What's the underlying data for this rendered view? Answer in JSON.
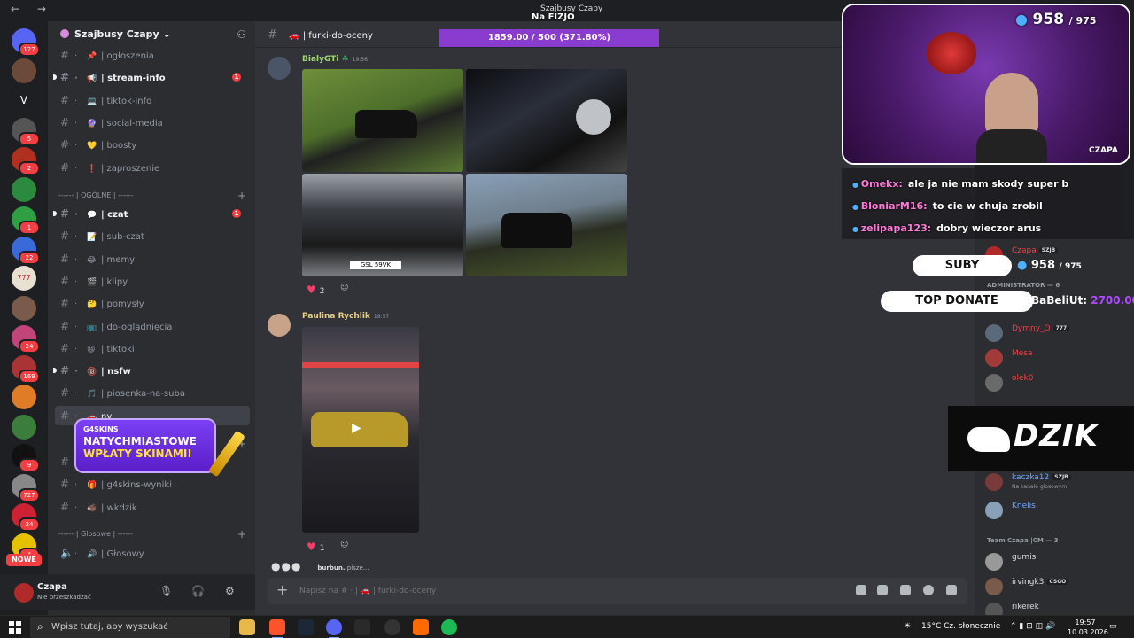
{
  "window": {
    "title": "Szajbusy Czapy"
  },
  "rail": {
    "servers": [
      {
        "badge": "127",
        "color": "#5865f2"
      },
      {
        "badge": "",
        "color": "#6b4a3a"
      },
      {
        "badge": "",
        "letter": "V",
        "color": "#1e1f22"
      },
      {
        "badge": "5",
        "color": "#555"
      },
      {
        "badge": "2",
        "color": "#b0301f"
      },
      {
        "badge": "",
        "color": "#2b8a3e"
      },
      {
        "badge": "1",
        "color": "#2ea043"
      },
      {
        "badge": "22",
        "color": "#3a6ad9"
      },
      {
        "badge": "",
        "letter": "777",
        "color": "#e8e0d0"
      },
      {
        "badge": "",
        "color": "#7a5a4a"
      },
      {
        "badge": "24",
        "color": "#c2457a"
      },
      {
        "badge": "169",
        "color": "#a33"
      },
      {
        "badge": "",
        "color": "#e07b28"
      },
      {
        "badge": "",
        "color": "#3b7d3b"
      },
      {
        "badge": "9",
        "color": "#111"
      },
      {
        "badge": "727",
        "color": "#888"
      },
      {
        "badge": "34",
        "color": "#c23"
      },
      {
        "badge": "4",
        "color": "#e5c100"
      }
    ],
    "nowe": "NOWE"
  },
  "sidebar": {
    "server_name": "Szajbusy Czapy",
    "channels_top": [
      {
        "emoji": "📌",
        "name": "| ogłoszenia",
        "bold": false,
        "badge": ""
      },
      {
        "emoji": "📢",
        "name": "| stream-info",
        "bold": true,
        "badge": "1"
      },
      {
        "emoji": "💻",
        "name": "| tiktok-info",
        "bold": false,
        "badge": ""
      },
      {
        "emoji": "🔮",
        "name": "| social-media",
        "bold": false,
        "badge": ""
      },
      {
        "emoji": "💛",
        "name": "| boosty",
        "bold": false,
        "badge": ""
      },
      {
        "emoji": "❗",
        "name": "| zaproszenie",
        "bold": false,
        "badge": ""
      }
    ],
    "category_general": "------ | OGÓLNE | ------",
    "channels_general": [
      {
        "emoji": "💬",
        "name": "| czat",
        "bold": true,
        "badge": "1"
      },
      {
        "emoji": "📝",
        "name": "| sub-czat",
        "bold": false,
        "badge": ""
      },
      {
        "emoji": "😂",
        "name": "| memy",
        "bold": false,
        "badge": ""
      },
      {
        "emoji": "🎬",
        "name": "| klipy",
        "bold": false,
        "badge": ""
      },
      {
        "emoji": "🤔",
        "name": "| pomysły",
        "bold": false,
        "badge": ""
      },
      {
        "emoji": "📺",
        "name": "| do-oglądnięcia",
        "bold": false,
        "badge": ""
      },
      {
        "emoji": "😆",
        "name": "| tiktoki",
        "bold": false,
        "badge": ""
      },
      {
        "emoji": "🔞",
        "name": "| nsfw",
        "bold": true,
        "badge": ""
      },
      {
        "emoji": "🎵",
        "name": "| piosenka-na-suba",
        "bold": false,
        "badge": ""
      },
      {
        "emoji": "🚗",
        "name": "ny",
        "bold": false,
        "badge": "",
        "active": true
      }
    ],
    "channels_g4": [
      {
        "emoji": "🎁",
        "name": "| g4skins",
        "bold": false,
        "badge": ""
      },
      {
        "emoji": "🎁",
        "name": "| g4skins-wyniki",
        "bold": false,
        "badge": ""
      },
      {
        "emoji": "🐗",
        "name": "| wkdzik",
        "bold": false,
        "badge": ""
      }
    ],
    "category_voice": "------ | Glosowe | ------",
    "voice": [
      {
        "emoji": "🔊",
        "name": "| Głosowy"
      }
    ],
    "promo": {
      "brand": "G4SKINS",
      "line1": "NATYCHMIASTOWE",
      "line2": "WPŁATY SKINAMI!"
    }
  },
  "user": {
    "name": "Czapa",
    "status": "Nie przeszkadzać"
  },
  "channel": {
    "name": "| furki-do-oceny",
    "emoji": "🚗"
  },
  "goal": {
    "label": "1859.00 / 500 (371.80%)",
    "overlay_text": "Na FIZJO",
    "progress": 1.0
  },
  "messages": [
    {
      "author": "BialyGTi",
      "time": "19:56",
      "author_color": "#a3d977",
      "reactions": [
        {
          "emoji": "❤️",
          "count": "2"
        }
      ]
    },
    {
      "author": "Paulina Rychlik",
      "time": "19:57",
      "author_color": "#e6d08a",
      "reactions": [
        {
          "emoji": "❤️",
          "count": "1"
        }
      ]
    }
  ],
  "typing": {
    "user": "burbun.",
    "text": "pisze..."
  },
  "composer": {
    "placeholder": "Napisz na # · | 🚗 | furki-do-oceny"
  },
  "overlay": {
    "sub_current": "958",
    "sub_goal": "/ 975",
    "cam_label": "CZAPA",
    "chat": [
      {
        "user": "Omekx:",
        "text": "ale ja nie mam skody super b",
        "color": "#ff7ad9"
      },
      {
        "user": "BloniarM16:",
        "text": "to cie w chuja zrobil",
        "color": "#ff7ad9"
      },
      {
        "user": "zelipapa123:",
        "text": "dobry wieczor arus",
        "color": "#ff7ad9"
      }
    ],
    "suby_label": "SUBY",
    "suby_value": "958",
    "suby_goal": "/ 975",
    "top_donate_label": "TOP DONATE",
    "top_donate_user": "BaBeliUt:",
    "top_donate_value": "2700.00",
    "dzik_text": "DZIK"
  },
  "members": {
    "admin_header": "ADMINISTRATOR — 6",
    "team_header": "Team Czapa |CM — 3",
    "list": [
      {
        "name": "Czapa",
        "color": "#f23f43",
        "tag": "SZJB",
        "sub": ""
      },
      {
        "name": "Dymny_O",
        "color": "#f23f43",
        "tag": "777",
        "sub": ""
      },
      {
        "name": "Mesa",
        "color": "#f23f43",
        "tag": "",
        "sub": ""
      },
      {
        "name": "olek0",
        "color": "#f23f43",
        "tag": "",
        "sub": ""
      },
      {
        "name": "kaczka12",
        "color": "#6ea8ff",
        "tag": "SZJB",
        "sub": "Na kanale głosowym"
      },
      {
        "name": "Knelis",
        "color": "#6ea8ff",
        "tag": "",
        "sub": ""
      },
      {
        "name": "gumis",
        "color": "#dbdee1",
        "tag": "",
        "sub": ""
      },
      {
        "name": "irvingk3",
        "color": "#dbdee1",
        "tag": "CSGO",
        "sub": ""
      },
      {
        "name": "rikerek",
        "color": "#dbdee1",
        "tag": "",
        "sub": ""
      }
    ],
    "voice_note": "Na kanale głosowym"
  },
  "taskbar": {
    "search_placeholder": "Wpisz tutaj, aby wyszukać",
    "weather": "15°C  Cz. słonecznie",
    "time": "19:57",
    "date": "10.03.2026"
  }
}
